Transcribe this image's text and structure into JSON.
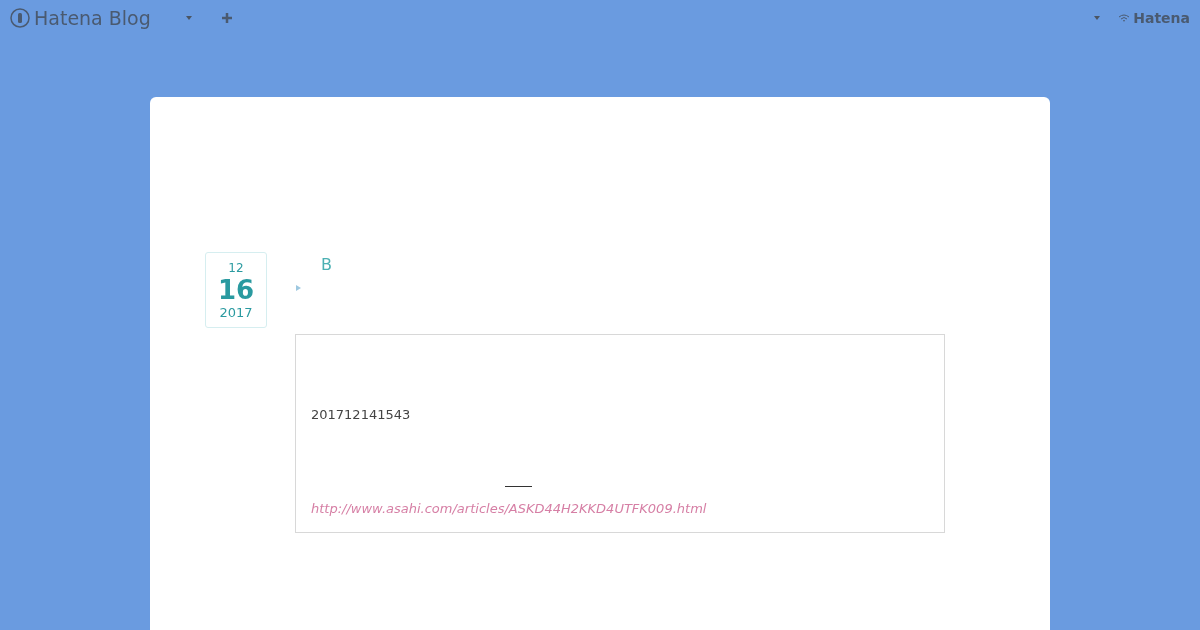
{
  "header": {
    "logo": "Hatena Blog",
    "account": "Hatena"
  },
  "entry": {
    "date": {
      "month": "12",
      "day": "16",
      "year": "2017"
    },
    "title": "B",
    "quote": {
      "text": "201712141543",
      "link": "http://www.asahi.com/articles/ASKD44H2KKD4UTFK009.html"
    }
  }
}
